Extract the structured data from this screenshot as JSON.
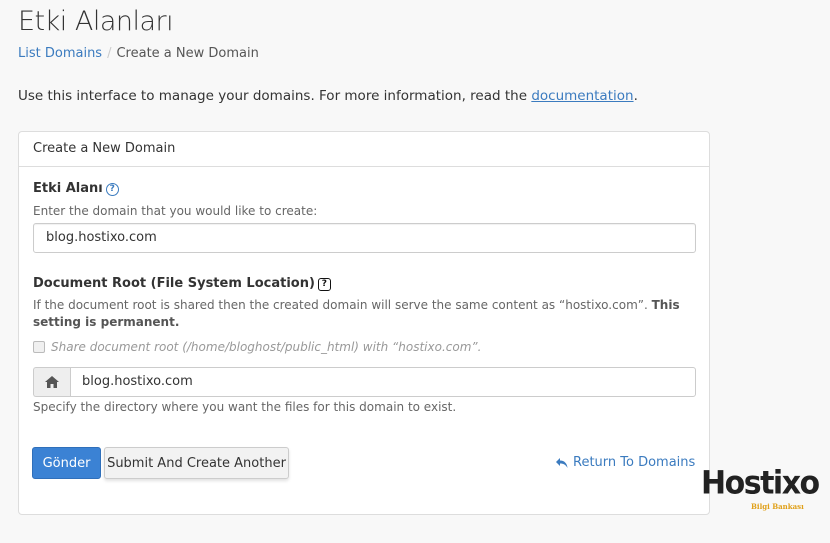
{
  "page": {
    "title": "Etki Alanları",
    "breadcrumb": {
      "link": "List Domains",
      "separator": "/",
      "current": "Create a New Domain"
    },
    "intro_text": "Use this interface to manage your domains. For more information, read the ",
    "intro_link": "documentation",
    "intro_end": "."
  },
  "panel": {
    "heading": "Create a New Domain",
    "domain_field": {
      "label": "Etki Alanı",
      "hint": "Enter the domain that you would like to create:",
      "value": "blog.hostixo.com"
    },
    "docroot_field": {
      "label": "Document Root (File System Location)",
      "hint_text": "If the document root is shared then the created domain will serve the same content as “hostixo.com”. ",
      "hint_bold": "This setting is permanent",
      "hint_end": ".",
      "checkbox_label": "Share document root (/home/bloghost/public_html) with “hostixo.com”.",
      "value": "blog.hostixo.com",
      "addon_icon": "home-icon",
      "help_text": "Specify the directory where you want the files for this domain to exist."
    },
    "help_icon_glyph": "?",
    "buttons": {
      "submit": "Gönder",
      "submit_another": "Submit And Create Another",
      "return": "Return To Domains"
    }
  },
  "logo": {
    "word": "Hostixo",
    "sub": "Bilgi Bankası"
  },
  "colors": {
    "link": "#3b7bbf",
    "primary_button": "#3b82d4",
    "logo_accent": "#e0a019"
  }
}
